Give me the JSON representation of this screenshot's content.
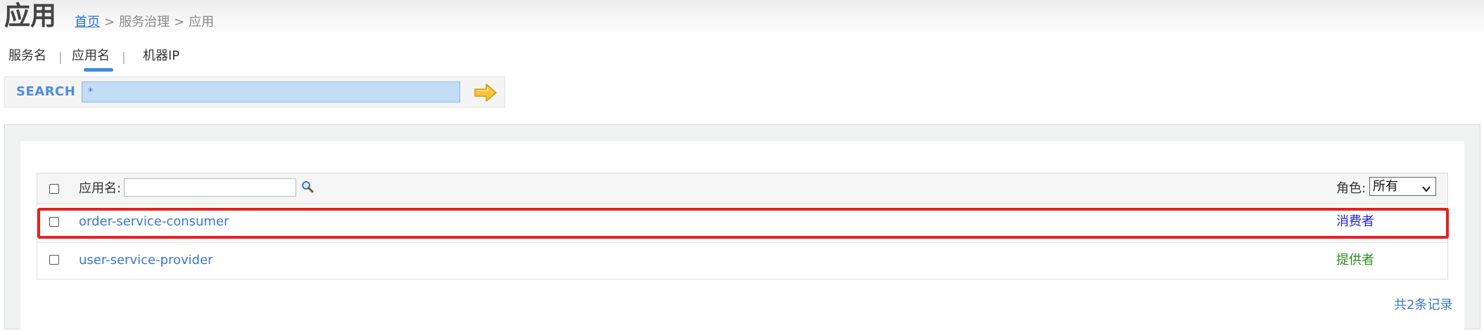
{
  "header": {
    "title": "应用",
    "breadcrumb": {
      "home": "首页",
      "separator": ">",
      "section": "服务治理",
      "current": "应用"
    }
  },
  "tabs": [
    {
      "label": "服务名"
    },
    {
      "label": "应用名"
    },
    {
      "label": "机器IP"
    }
  ],
  "tab_divider": "|",
  "active_tab": "应用名",
  "search": {
    "label": "SEARCH",
    "value": "*",
    "go_icon": "arrow-right-icon"
  },
  "table": {
    "header": {
      "app_column_label": "应用名:",
      "filter_value": "",
      "filter_icon": "magnifier-icon",
      "role_label": "角色:",
      "role_selected": "所有"
    },
    "rows": [
      {
        "app_name": "order-service-consumer",
        "role": "消费者",
        "role_color": "#2525cc",
        "highlighted": true
      },
      {
        "app_name": "user-service-provider",
        "role": "提供者",
        "role_color": "#2d8a1d",
        "highlighted": false
      }
    ],
    "footer": {
      "record_count": "共2条记录"
    }
  },
  "colors": {
    "link": "#3a78d0",
    "highlight_border": "#e52020",
    "search_input_bg": "#c3dcf6",
    "tab_underline": "#3d8ed7"
  }
}
